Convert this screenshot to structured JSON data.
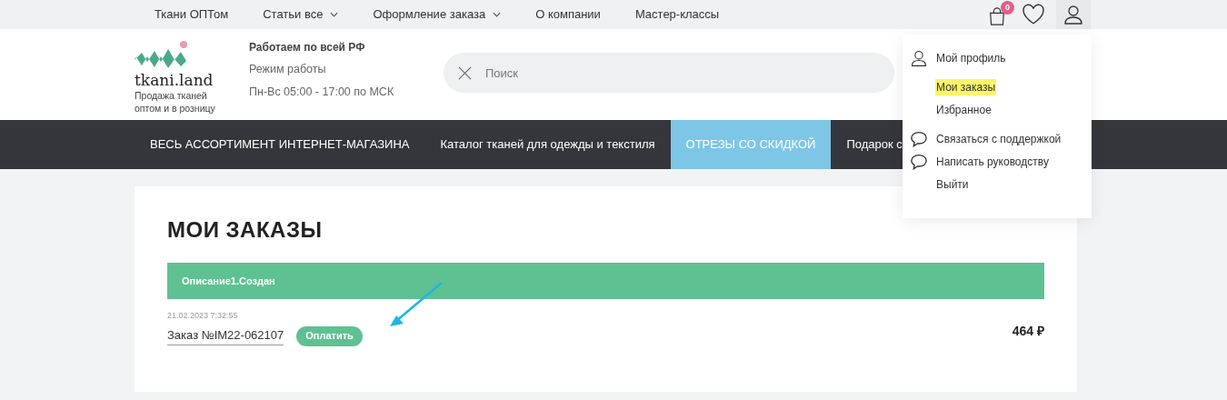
{
  "top_nav": [
    {
      "label": "Ткани ОПТом",
      "has_dropdown": false
    },
    {
      "label": "Статьи все",
      "has_dropdown": true
    },
    {
      "label": "Оформление заказа",
      "has_dropdown": true
    },
    {
      "label": "О компании",
      "has_dropdown": false
    },
    {
      "label": "Мастер-классы",
      "has_dropdown": false
    }
  ],
  "cart_count": "0",
  "header": {
    "logo_text": "tkani.land",
    "tagline": "Продажа тканей оптом и в розницу",
    "info_title": "Работаем по всей РФ",
    "hours_label": "Режим работы",
    "hours": "Пн-Вс 05:00 - 17:00 по МСК",
    "search": {
      "placeholder": "Поиск"
    }
  },
  "categories": [
    {
      "label": "ВЕСЬ АССОРТИМЕНТ ИНТЕРНЕТ-МАГАЗИНА",
      "selected": false
    },
    {
      "label": "Каталог тканей для одежды и текстиля",
      "selected": false
    },
    {
      "label": "ОТРЕЗЫ СО СКИДКОЙ",
      "selected": true
    },
    {
      "label": "Подарок с",
      "selected": false
    }
  ],
  "page_title": "МОИ ЗАКАЗЫ",
  "order_group": {
    "title": "Описание1.Создан",
    "orders": [
      {
        "date": "21.02.2023 7:32:55",
        "number": "Заказ №IM22-062107",
        "pay_button": "Оплатить",
        "price": "464 ₽"
      }
    ]
  },
  "user_menu": [
    {
      "label": "Мой профиль",
      "kind": "profile",
      "highlighted": false
    },
    {
      "label": "Мои заказы",
      "kind": "plain",
      "highlighted": true
    },
    {
      "label": "Избранное",
      "kind": "plain",
      "highlighted": false
    },
    {
      "label": "Связаться с поддержкой",
      "kind": "chat",
      "highlighted": false
    },
    {
      "label": "Написать руководству",
      "kind": "chat",
      "highlighted": false
    },
    {
      "label": "Выйти",
      "kind": "plain",
      "highlighted": false
    }
  ]
}
